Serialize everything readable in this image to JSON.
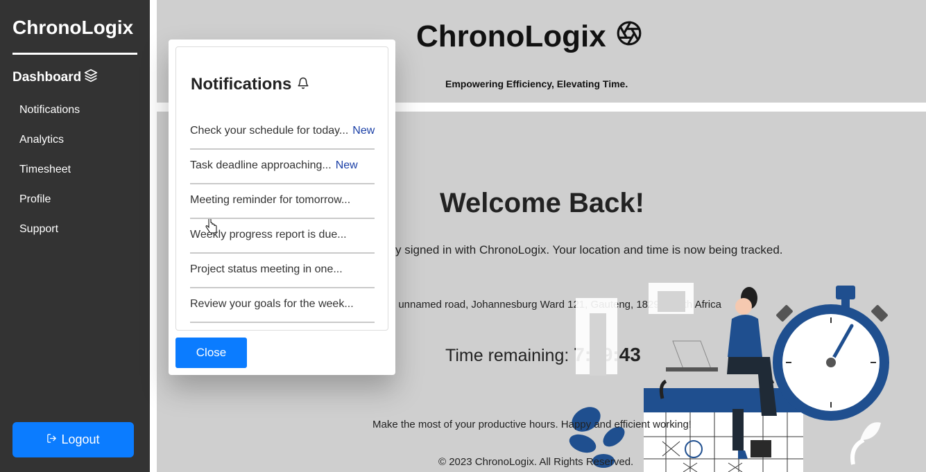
{
  "sidebar": {
    "brand": "ChronoLogix",
    "dashboard_label": "Dashboard",
    "items": [
      {
        "label": "Notifications"
      },
      {
        "label": "Analytics"
      },
      {
        "label": "Timesheet"
      },
      {
        "label": "Profile"
      },
      {
        "label": "Support"
      }
    ],
    "logout_label": "Logout"
  },
  "header": {
    "title": "ChronoLogix",
    "tagline": "Empowering Efficiency, Elevating Time."
  },
  "main": {
    "welcome": "Welcome Back!",
    "signed_in_text": "y signed in with ChronoLogix. Your location and time is now being tracked.",
    "location_text": ": unnamed road, Johannesburg Ward 121, Gauteng, 1829, South Africa",
    "time_remaining_label": "Time remaining:",
    "time_remaining_value": "7:59:43",
    "motto": "Make the most of your productive hours. Happy and efficient working!",
    "footer": "© 2023 ChronoLogix. All Rights Reserved."
  },
  "notifications_modal": {
    "title": "Notifications",
    "items": [
      {
        "text": "Check your schedule for today...",
        "badge": "New"
      },
      {
        "text": "Task deadline approaching...",
        "badge": "New"
      },
      {
        "text": "Meeting reminder for tomorrow...",
        "badge": ""
      },
      {
        "text": "Weekly progress report is due...",
        "badge": ""
      },
      {
        "text": "Project status meeting in one...",
        "badge": ""
      },
      {
        "text": "Review your goals for the week...",
        "badge": ""
      }
    ],
    "close_label": "Close"
  },
  "colors": {
    "sidebar_bg": "#333333",
    "accent_blue": "#0b7cff",
    "new_badge": "#1a3fa6",
    "page_bg": "#cfcfcf",
    "illustration_navy": "#1f4f8f"
  }
}
